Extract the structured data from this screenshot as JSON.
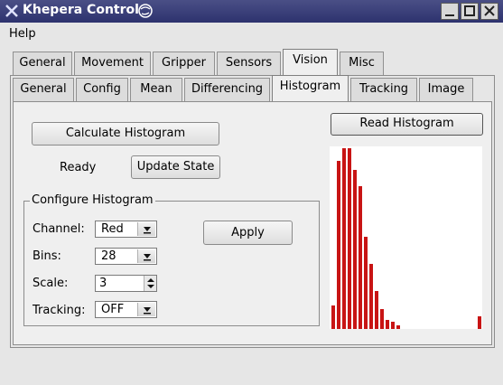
{
  "window": {
    "title": "Khepera Control",
    "icons": [
      "x-logo-icon",
      "globe-icon",
      "minimize-icon",
      "maximize-icon",
      "close-icon"
    ]
  },
  "menu": {
    "help": "Help"
  },
  "main_tabs": [
    {
      "label": "General"
    },
    {
      "label": "Movement"
    },
    {
      "label": "Gripper"
    },
    {
      "label": "Sensors"
    },
    {
      "label": "Vision",
      "active": true
    },
    {
      "label": "Misc"
    }
  ],
  "sub_tabs": [
    {
      "label": "General"
    },
    {
      "label": "Config"
    },
    {
      "label": "Mean"
    },
    {
      "label": "Differencing"
    },
    {
      "label": "Histogram",
      "active": true
    },
    {
      "label": "Tracking"
    },
    {
      "label": "Image"
    }
  ],
  "histogram_panel": {
    "calculate_label": "Calculate Histogram",
    "status": "Ready",
    "update_label": "Update State",
    "read_label": "Read Histogram",
    "config": {
      "title": "Configure Histogram",
      "channel_label": "Channel:",
      "channel_value": "Red",
      "bins_label": "Bins:",
      "bins_value": "28",
      "scale_label": "Scale:",
      "scale_value": "3",
      "tracking_label": "Tracking:",
      "tracking_value": "OFF",
      "apply_label": "Apply"
    }
  },
  "chart_data": {
    "type": "bar",
    "color": "#c81414",
    "values": [
      0.13,
      0.93,
      1.0,
      1.0,
      0.88,
      0.79,
      0.51,
      0.36,
      0.21,
      0.11,
      0.05,
      0.04,
      0.02,
      0.0,
      0.0,
      0.0,
      0.0,
      0.0,
      0.0,
      0.0,
      0.0,
      0.0,
      0.0,
      0.0,
      0.0,
      0.0,
      0.0,
      0.07
    ]
  }
}
